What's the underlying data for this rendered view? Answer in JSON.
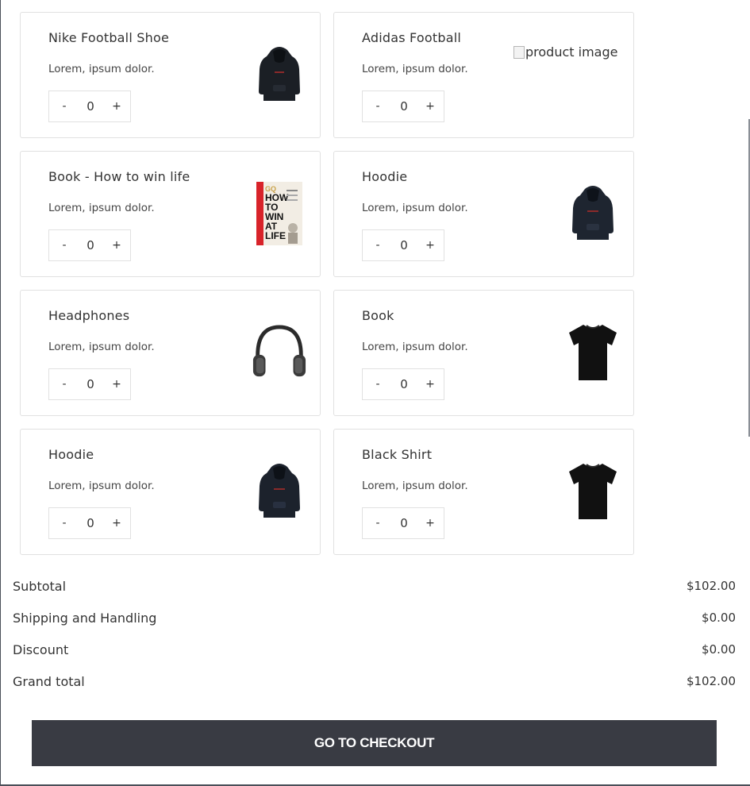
{
  "products": [
    {
      "title": "Nike Football Shoe",
      "desc": "Lorem, ipsum dolor.",
      "qty": "0",
      "minus": "-",
      "plus": "+",
      "image": "hoodie-icon",
      "broken_alt": ""
    },
    {
      "title": "Adidas Football",
      "desc": "Lorem, ipsum dolor.",
      "qty": "0",
      "minus": "-",
      "plus": "+",
      "image": "broken-image-icon",
      "broken_alt": "product image"
    },
    {
      "title": "Book - How to win life",
      "desc": "Lorem, ipsum dolor.",
      "qty": "0",
      "minus": "-",
      "plus": "+",
      "image": "book-cover-icon",
      "broken_alt": "",
      "cover_lines": [
        "GQ",
        "HOW",
        "TO",
        "WIN",
        "AT",
        "LIFE"
      ]
    },
    {
      "title": "Hoodie",
      "desc": "Lorem, ipsum dolor.",
      "qty": "0",
      "minus": "-",
      "plus": "+",
      "image": "hoodie-icon",
      "broken_alt": ""
    },
    {
      "title": "Headphones",
      "desc": "Lorem, ipsum dolor.",
      "qty": "0",
      "minus": "-",
      "plus": "+",
      "image": "headphones-icon",
      "broken_alt": ""
    },
    {
      "title": "Book",
      "desc": "Lorem, ipsum dolor.",
      "qty": "0",
      "minus": "-",
      "plus": "+",
      "image": "tshirt-icon",
      "broken_alt": ""
    },
    {
      "title": "Hoodie",
      "desc": "Lorem, ipsum dolor.",
      "qty": "0",
      "minus": "-",
      "plus": "+",
      "image": "hoodie-icon",
      "broken_alt": ""
    },
    {
      "title": "Black Shirt",
      "desc": "Lorem, ipsum dolor.",
      "qty": "0",
      "minus": "-",
      "plus": "+",
      "image": "tshirt-icon",
      "broken_alt": ""
    }
  ],
  "summary": [
    {
      "label": "Subtotal",
      "amount": "$102.00"
    },
    {
      "label": "Shipping and Handling",
      "amount": "$0.00"
    },
    {
      "label": "Discount",
      "amount": "$0.00"
    },
    {
      "label": "Grand total",
      "amount": "$102.00"
    }
  ],
  "checkout": {
    "label": "GO TO CHECKOUT"
  },
  "colors": {
    "button_bg": "#393b43",
    "card_border": "#e1e1e1",
    "book_red": "#d8232a"
  }
}
